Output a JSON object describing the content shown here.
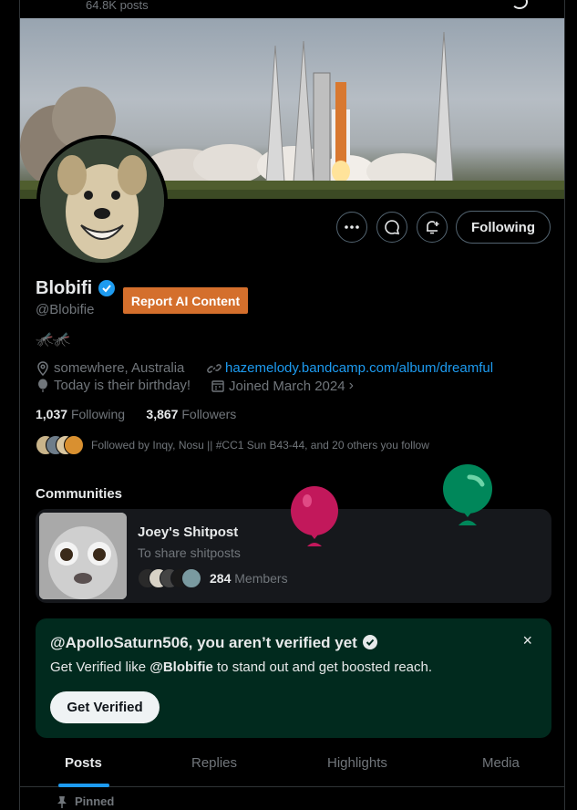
{
  "header": {
    "post_count": "64.8K posts"
  },
  "profile": {
    "name": "Blobifi",
    "handle": "@Blobifie",
    "bio": "🦟🦟",
    "report_button": "Report AI Content",
    "location": "somewhere, Australia",
    "website": "hazemelody.bandcamp.com/album/dreamful",
    "birthday": "Today is their birthday!",
    "joined": "Joined March 2024",
    "following_count": "1,037",
    "following_label": "Following",
    "followers_count": "3,867",
    "followers_label": "Followers",
    "followed_by": "Followed by Inqy, Nosu || #CC1 Sun B43-44, and 20 others you follow"
  },
  "actions": {
    "more": "more-icon",
    "message": "message-icon",
    "notify": "notification-bell-icon",
    "follow_label": "Following"
  },
  "communities": {
    "title": "Communities",
    "card": {
      "name": "Joey's Shitpost",
      "description": "To share shitposts",
      "members_count": "284",
      "members_label": "Members"
    }
  },
  "verify_banner": {
    "title": "@ApolloSaturn506, you aren’t verified yet",
    "desc_prefix": "Get Verified like ",
    "desc_handle": "@Blobifie",
    "desc_suffix": " to stand out and get boosted reach.",
    "button": "Get Verified",
    "close": "×"
  },
  "tabs": [
    {
      "label": "Posts",
      "active": true
    },
    {
      "label": "Replies",
      "active": false
    },
    {
      "label": "Highlights",
      "active": false
    },
    {
      "label": "Media",
      "active": false
    }
  ],
  "pinned_label": "Pinned",
  "colors": {
    "accent": "#1d9bf0",
    "report": "#d46f2c",
    "verify_bg": "#012a1e",
    "balloon_pink": "#c2185b",
    "balloon_green": "#00875a"
  }
}
